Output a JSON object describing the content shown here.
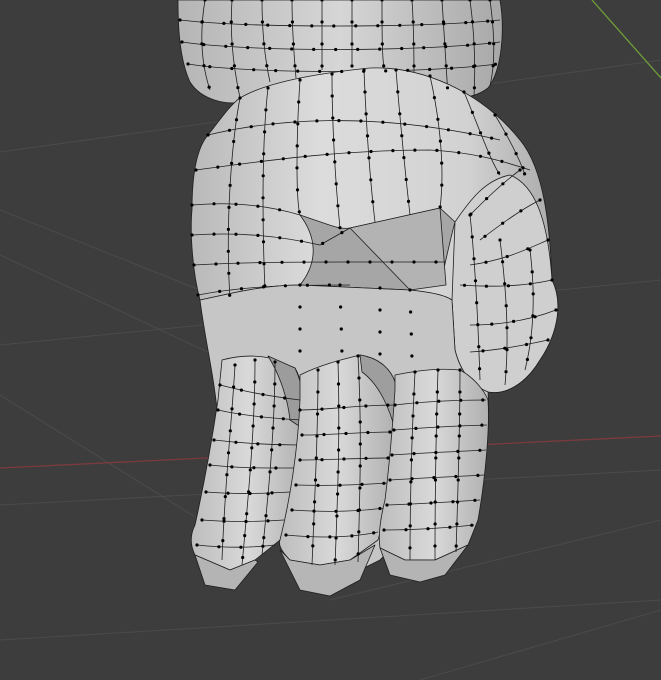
{
  "viewport": {
    "background_color": "#3d3d3d",
    "mode": "edit-mode",
    "colors": {
      "grid_line": "#4a4a4a",
      "x_axis": "#8a3a3d",
      "y_axis": "#6f9e3a",
      "mesh_fill_light": "#d8d8d8",
      "mesh_fill_mid": "#bdbdbd",
      "mesh_fill_dark": "#9a9a9a",
      "mesh_edge": "#1c1c1c",
      "mesh_vertex": "#000000"
    }
  },
  "scene": {
    "objects": [
      {
        "name": "hand-mesh",
        "icon": "mesh-icon"
      }
    ]
  }
}
